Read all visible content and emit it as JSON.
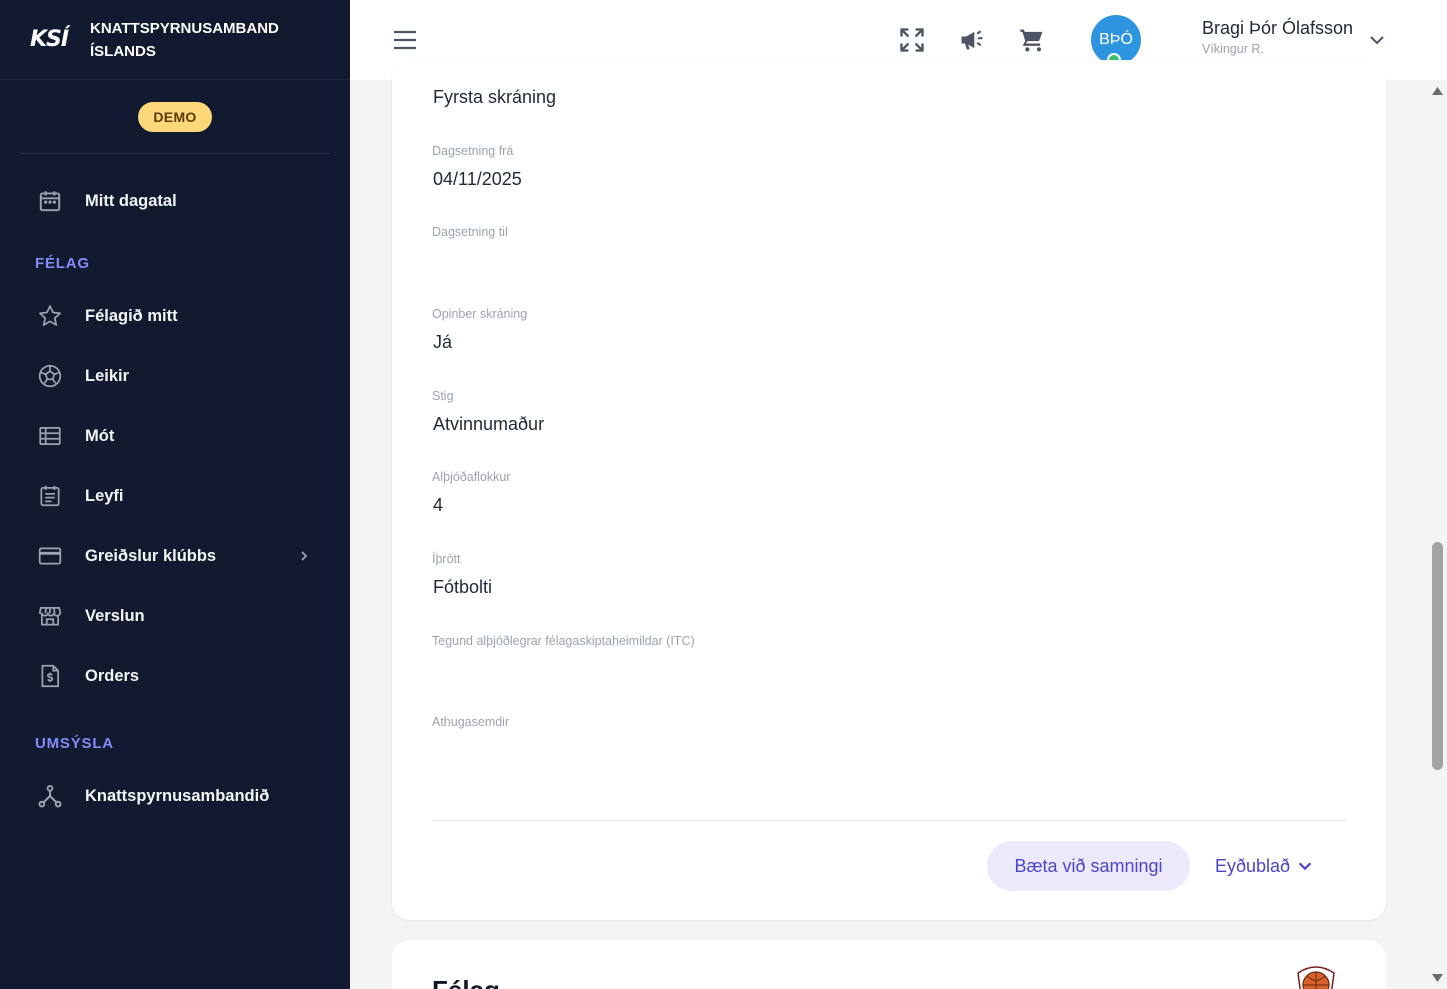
{
  "brand": {
    "logo": "KSÍ",
    "name_line1": "KNATTSPYRNUSAMBAND",
    "name_line2": "ÍSLANDS",
    "demo_badge": "DEMO"
  },
  "sidebar": {
    "calendar": {
      "label": "Mitt dagatal",
      "icon": "calendar-icon"
    },
    "section_club": "FÉLAG",
    "items": [
      {
        "label": "Félagið mitt",
        "icon": "star-icon"
      },
      {
        "label": "Leikir",
        "icon": "soccer-ball-icon"
      },
      {
        "label": "Mót",
        "icon": "table-list-icon"
      },
      {
        "label": "Leyfi",
        "icon": "license-icon"
      },
      {
        "label": "Greiðslur klúbbs",
        "icon": "credit-card-icon",
        "has_submenu": true
      },
      {
        "label": "Verslun",
        "icon": "store-icon"
      },
      {
        "label": "Orders",
        "icon": "invoice-icon"
      }
    ],
    "section_admin": "UMSÝSLA",
    "admin_items": [
      {
        "label": "Knattspyrnusambandið",
        "icon": "hierarchy-icon"
      }
    ]
  },
  "header": {
    "user": {
      "initials": "BÞÓ",
      "name": "Bragi Þór Ólafsson",
      "club": "Víkingur R.",
      "status_color": "#3ac46b"
    }
  },
  "main": {
    "first_value": "Fyrsta skráning",
    "fields": [
      {
        "label": "Dagsetning frá",
        "value": "04/11/2025"
      },
      {
        "label": "Dagsetning til",
        "value": ""
      },
      {
        "label": "Opinber skráning",
        "value": "Já"
      },
      {
        "label": "Stig",
        "value": "Atvinnumaður"
      },
      {
        "label": "Alþjóðaflokkur",
        "value": "4"
      },
      {
        "label": "Íþrótt",
        "value": "Fótbolti"
      },
      {
        "label": "Tegund alþjóðlegrar félagaskiptaheimildar (ITC)",
        "value": ""
      },
      {
        "label": "Athugasemdir",
        "value": ""
      }
    ],
    "add_contract_button": "Bæta við samningi",
    "form_button": "Eyðublað",
    "next_card_title": "Félag"
  },
  "colors": {
    "sidebar_bg": "#111a2e",
    "accent": "#4b46c6",
    "section_title": "#818cf8",
    "avatar_bg": "#2d95e0"
  }
}
